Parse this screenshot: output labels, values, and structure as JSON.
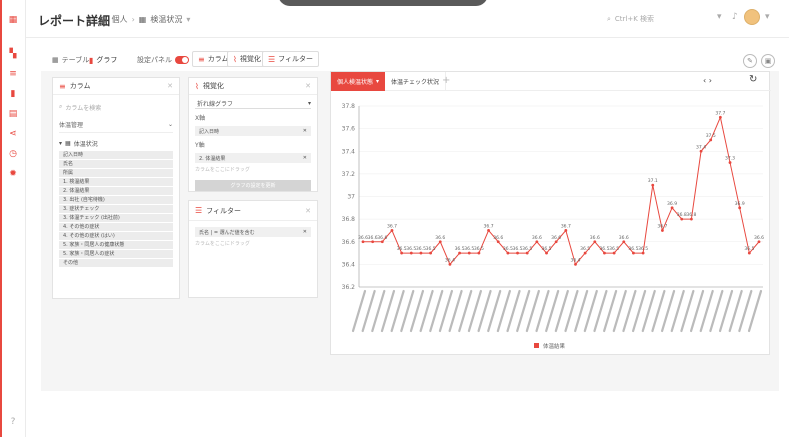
{
  "app": {
    "title": "レポート詳細",
    "breadcrumb": [
      "個人",
      "検温状況"
    ],
    "search_placeholder": "Ctrl+K 検索",
    "accent": "#e8483f"
  },
  "toolbar": {
    "table_label": "テーブル",
    "graph_label": "グラフ",
    "setting_panel_label": "設定パネル",
    "column_btn": "カラム",
    "visual_btn": "視覚化",
    "filter_btn": "フィルター"
  },
  "columns_panel": {
    "title": "カラム",
    "search_placeholder": "カラムを検索",
    "group_label": "体温管理",
    "sub_label": "体温状況",
    "items": [
      "記入日時",
      "氏名",
      "所属",
      "1. 検温結果",
      "2. 体温結果",
      "3. 出社 (自宅待機)",
      "3. 症状チェック",
      "3. 体温チェック (出社前)",
      "4. その他の症状",
      "4. その他の症状 (はい)",
      "5. 家族・同居人の健康状態",
      "5. 家族・同居人の症状",
      "その他"
    ]
  },
  "visual_panel": {
    "title": "視覚化",
    "chart_type": "折れ線グラフ",
    "x_label": "X軸",
    "x_field": "記入日時",
    "y_label": "Y軸",
    "y_field": "2. 体温結果",
    "hint": "カラムをここにドラッグ",
    "apply_btn": "グラフの設定を更新"
  },
  "filter_panel": {
    "title": "フィルター",
    "field": "氏名 | = 選んだ値を含む",
    "hint": "カラムをここにドラッグ"
  },
  "chart_panel": {
    "tab_active": "個人検温状態",
    "tab_inactive": "体温チェック状況",
    "nav": "‹ ›"
  },
  "chart_data": {
    "type": "line",
    "series": [
      {
        "name": "体温結果",
        "color": "#e8483f",
        "values": [
          36.6,
          36.6,
          36.6,
          36.7,
          36.5,
          36.5,
          36.5,
          36.5,
          36.6,
          36.4,
          36.5,
          36.5,
          36.5,
          36.7,
          36.6,
          36.5,
          36.5,
          36.5,
          36.6,
          36.5,
          36.6,
          36.7,
          36.4,
          36.5,
          36.6,
          36.5,
          36.5,
          36.6,
          36.5,
          36.5,
          37.1,
          36.7,
          36.9,
          36.8,
          36.8,
          37.4,
          37.5,
          37.7,
          37.3,
          36.9,
          36.5,
          36.6
        ]
      }
    ],
    "ylim": [
      36.2,
      37.8
    ],
    "yticks": [
      36.2,
      36.4,
      36.6,
      36.8,
      37,
      37.2,
      37.4,
      37.6,
      37.8
    ],
    "legend": "bottom-center"
  }
}
